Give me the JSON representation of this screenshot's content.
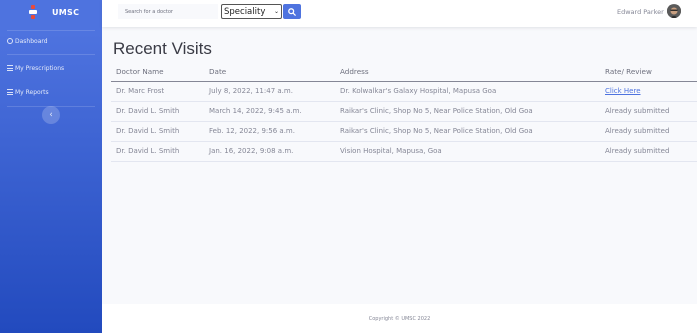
{
  "brand": {
    "name": "UMSC"
  },
  "sidebar": {
    "items": [
      {
        "label": "Dashboard",
        "icon": "dashboard-icon"
      },
      {
        "label": "My Prescriptions",
        "icon": "list-icon"
      },
      {
        "label": "My Reports",
        "icon": "list-icon"
      }
    ],
    "toggle_icon": "‹"
  },
  "topbar": {
    "search_placeholder": "Search for a doctor",
    "speciality_value": "Speciality",
    "user_name": "Edward Parker"
  },
  "main": {
    "title": "Recent Visits",
    "columns": [
      "Doctor Name",
      "Date",
      "Address",
      "Rate/ Review"
    ],
    "rows": [
      {
        "doctor": "Dr. Marc Frost",
        "date": "July 8, 2022, 11:47 a.m.",
        "address": "Dr. Kolwalkar's Galaxy Hospital, Mapusa Goa",
        "review": "Click Here",
        "review_is_link": true
      },
      {
        "doctor": "Dr. David L. Smith",
        "date": "March 14, 2022, 9:45 a.m.",
        "address": "Raikar's Clinic, Shop No 5, Near Police Station, Old Goa",
        "review": "Already submitted",
        "review_is_link": false
      },
      {
        "doctor": "Dr. David L. Smith",
        "date": "Feb. 12, 2022, 9:56 a.m.",
        "address": "Raikar's Clinic, Shop No 5, Near Police Station, Old Goa",
        "review": "Already submitted",
        "review_is_link": false
      },
      {
        "doctor": "Dr. David L. Smith",
        "date": "Jan. 16, 2022, 9:08 a.m.",
        "address": "Vision Hospital, Mapusa, Goa",
        "review": "Already submitted",
        "review_is_link": false
      }
    ]
  },
  "footer": {
    "text": "Copyright © UMSC 2022"
  },
  "colors": {
    "primary": "#4e73df",
    "primary_dark": "#224abe",
    "text_muted": "#858796",
    "logo_red": "#e74a3b"
  }
}
